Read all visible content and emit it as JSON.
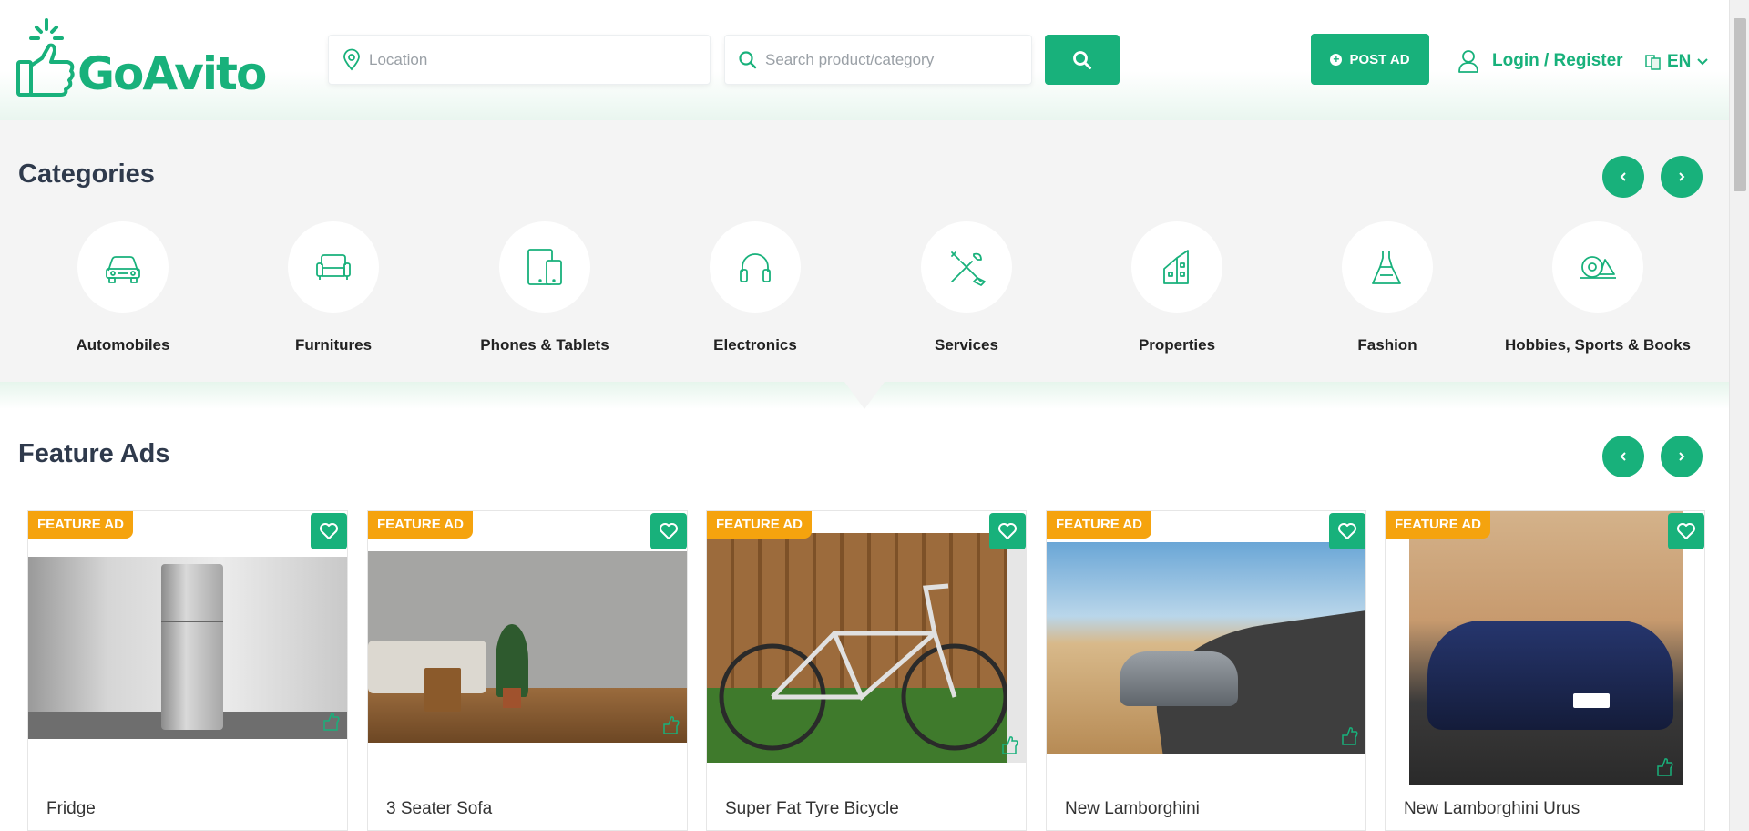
{
  "brand": {
    "name": "GoAvito",
    "color": "#18b17b"
  },
  "header": {
    "location_placeholder": "Location",
    "search_placeholder": "Search product/category",
    "post_ad_label": "POST AD",
    "login_label": "Login / Register",
    "language": "EN"
  },
  "categories": {
    "title": "Categories",
    "items": [
      {
        "label": "Automobiles",
        "icon": "car-icon"
      },
      {
        "label": "Furnitures",
        "icon": "sofa-icon"
      },
      {
        "label": "Phones & Tablets",
        "icon": "phone-tablet-icon"
      },
      {
        "label": "Electronics",
        "icon": "headphones-icon"
      },
      {
        "label": "Services",
        "icon": "tools-icon"
      },
      {
        "label": "Properties",
        "icon": "house-icon"
      },
      {
        "label": "Fashion",
        "icon": "dress-icon"
      },
      {
        "label": "Hobbies, Sports & Books",
        "icon": "sports-icon"
      }
    ]
  },
  "feature_ads": {
    "title": "Feature Ads",
    "badge": "FEATURE AD",
    "items": [
      {
        "title": "Fridge"
      },
      {
        "title": "3 Seater Sofa"
      },
      {
        "title": "Super Fat Tyre Bicycle"
      },
      {
        "title": "New Lamborghini"
      },
      {
        "title": "New Lamborghini Urus"
      }
    ]
  },
  "colors": {
    "accent": "#18b17b",
    "badge": "#f5a30e",
    "section_bg": "#f4f4f4"
  }
}
